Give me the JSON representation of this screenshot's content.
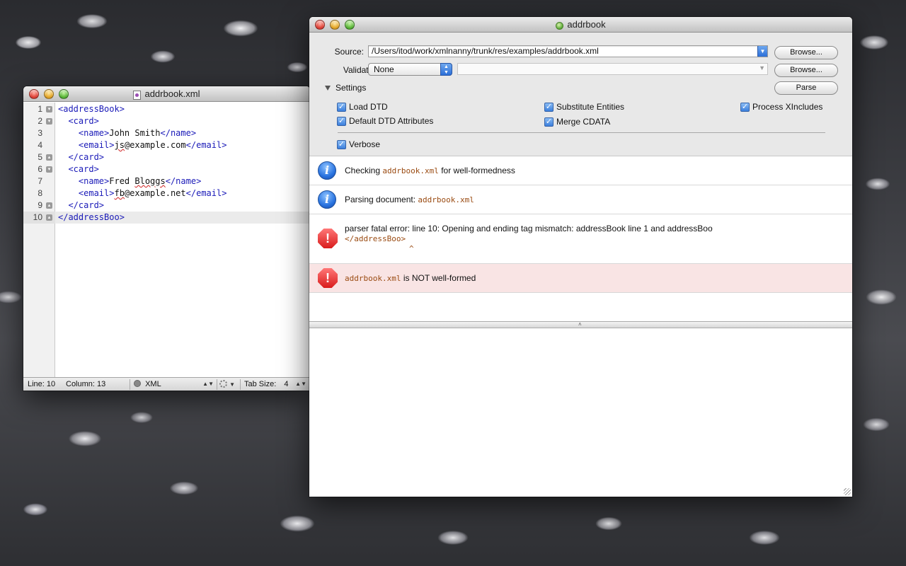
{
  "editor_window": {
    "title": "addrbook.xml",
    "lines": [
      {
        "num": "1",
        "fold": "▾",
        "parts": [
          {
            "t": "<addressBook>",
            "c": "tag"
          }
        ]
      },
      {
        "num": "2",
        "fold": "▾",
        "parts": [
          {
            "t": "  <card>",
            "c": "tag"
          }
        ]
      },
      {
        "num": "3",
        "fold": "",
        "parts": [
          {
            "t": "    <name>",
            "c": "tag"
          },
          {
            "t": "John Smith",
            "c": "plain"
          },
          {
            "t": "</name>",
            "c": "tag"
          }
        ]
      },
      {
        "num": "4",
        "fold": "",
        "parts": [
          {
            "t": "    <email>",
            "c": "tag"
          },
          {
            "t": "js",
            "c": "plain squig"
          },
          {
            "t": "@example.com",
            "c": "plain"
          },
          {
            "t": "</email>",
            "c": "tag"
          }
        ]
      },
      {
        "num": "5",
        "fold": "▴",
        "parts": [
          {
            "t": "  </card>",
            "c": "tag"
          }
        ]
      },
      {
        "num": "6",
        "fold": "▾",
        "parts": [
          {
            "t": "  <card>",
            "c": "tag"
          }
        ]
      },
      {
        "num": "7",
        "fold": "",
        "parts": [
          {
            "t": "    <name>",
            "c": "tag"
          },
          {
            "t": "Fred ",
            "c": "plain"
          },
          {
            "t": "Bloggs",
            "c": "plain squig"
          },
          {
            "t": "</name>",
            "c": "tag"
          }
        ]
      },
      {
        "num": "8",
        "fold": "",
        "parts": [
          {
            "t": "    <email>",
            "c": "tag"
          },
          {
            "t": "fb",
            "c": "plain squig"
          },
          {
            "t": "@example.net",
            "c": "plain"
          },
          {
            "t": "</email>",
            "c": "tag"
          }
        ]
      },
      {
        "num": "9",
        "fold": "▴",
        "parts": [
          {
            "t": "  </card>",
            "c": "tag"
          }
        ]
      },
      {
        "num": "10",
        "fold": "▴",
        "parts": [
          {
            "t": "</addressBoo>",
            "c": "tag"
          }
        ]
      }
    ],
    "current_line_index": 9,
    "status": {
      "line_label": "Line:",
      "line_value": "10",
      "column_label": "Column:",
      "column_value": "13",
      "syntax": "XML",
      "tab_size_label": "Tab Size:",
      "tab_size_value": "4"
    }
  },
  "nanny_window": {
    "title": "addrbook",
    "source_label": "Source:",
    "source_value": "/Users/itod/work/xmlnanny/trunk/res/examples/addrbook.xml",
    "validation_label": "Validation:",
    "validation_value": "None",
    "browse_label": "Browse...",
    "parse_label": "Parse",
    "settings_label": "Settings",
    "settings": {
      "load_dtd": "Load DTD",
      "default_dtd_attributes": "Default DTD Attributes",
      "substitute_entities": "Substitute Entities",
      "merge_cdata": "Merge CDATA",
      "process_xincludes": "Process XIncludes",
      "verbose": "Verbose",
      "checked": "✓"
    },
    "messages": {
      "m1_prefix": "Checking ",
      "m1_file": "addrbook.xml",
      "m1_suffix": " for well-formedness",
      "m2_prefix": "Parsing document: ",
      "m2_file": "addrbook.xml",
      "m3_text": "parser fatal error: line 10: Opening and ending tag mismatch: addressBook line 1 and addressBoo",
      "m3_code": "</addressBoo>",
      "m3_caret": "^",
      "m4_file": "addrbook.xml",
      "m4_suffix": " is NOT well-formed"
    },
    "icons": {
      "info": "i",
      "error": "!",
      "splitter": "˄"
    }
  }
}
